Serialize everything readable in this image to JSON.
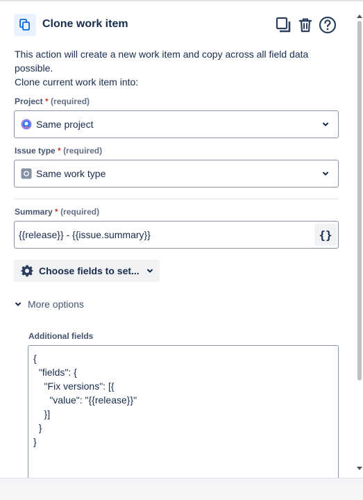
{
  "header": {
    "title": "Clone work item",
    "icon": "copy-icon",
    "actions": [
      "duplicate-icon",
      "trash-icon",
      "help-icon"
    ]
  },
  "description": {
    "line1": "This action will create a new work item and copy across all field data possible.",
    "line2": "Clone current work item into:"
  },
  "project": {
    "label": "Project",
    "required_mark": "*",
    "required_text": "(required)",
    "value": "Same project"
  },
  "issue_type": {
    "label": "Issue type",
    "required_mark": "*",
    "required_text": "(required)",
    "value": "Same work type"
  },
  "summary": {
    "label": "Summary",
    "required_mark": "*",
    "required_text": "(required)",
    "value": "{{release}} - {{issue.summary}}",
    "smart_value_button": "{}"
  },
  "choose_fields": {
    "label": "Choose fields to set..."
  },
  "more_options": {
    "label": "More options"
  },
  "additional_fields": {
    "label": "Additional fields",
    "value": "{\n  \"fields\": {\n    \"Fix versions\": [{\n      \"value\": \"{{release}}\"\n    }]\n  }\n}"
  },
  "colors": {
    "accent": "#0c66e4",
    "text": "#172b4d",
    "required": "#c9372c"
  }
}
